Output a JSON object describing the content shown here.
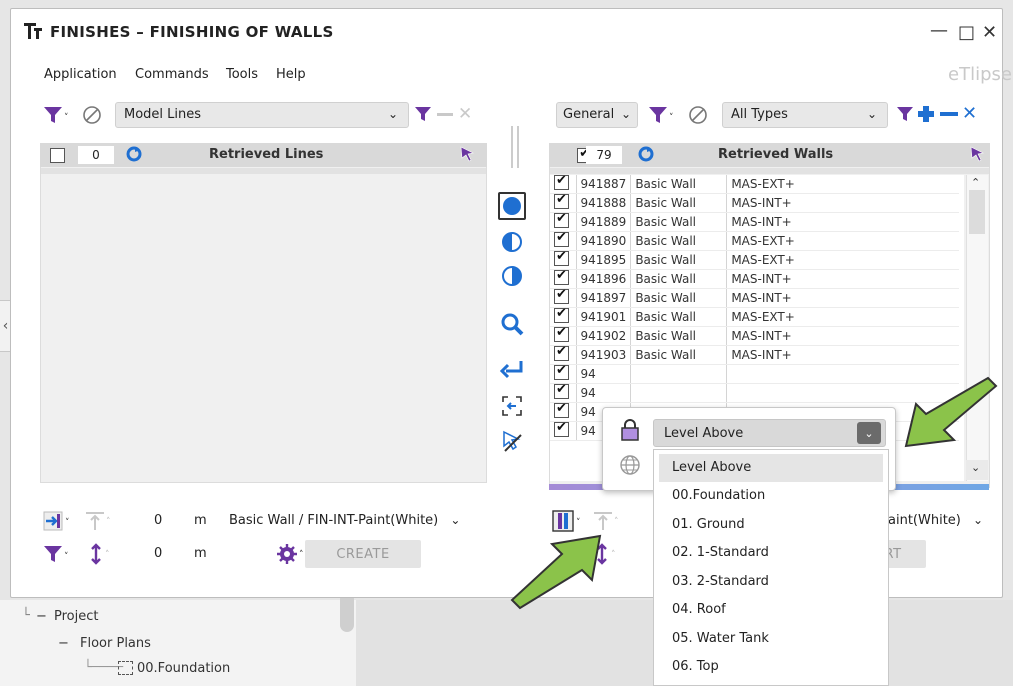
{
  "window": {
    "title": "FINISHES – FINISHING OF WALLS",
    "brand": "eTlipse",
    "controls": {
      "minimize": "—",
      "maximize": "□",
      "close": "✕"
    }
  },
  "menu": [
    "Application",
    "Commands",
    "Tools",
    "Help"
  ],
  "left_panel": {
    "category_select": "Model Lines",
    "count": "0",
    "header": "Retrieved Lines",
    "offset_value": "0",
    "offset_unit": "m",
    "wall_type_select": "Basic Wall / FIN-INT-Paint(White)",
    "height_value": "0",
    "height_unit": "m",
    "create_label": "CREATE"
  },
  "right_panel": {
    "filter_select": "General",
    "type_select": "All Types",
    "count": "79",
    "header": "Retrieved Walls",
    "rows": [
      {
        "id": "941887",
        "family": "Basic Wall",
        "type": "MAS-EXT+"
      },
      {
        "id": "941888",
        "family": "Basic Wall",
        "type": "MAS-INT+"
      },
      {
        "id": "941889",
        "family": "Basic Wall",
        "type": "MAS-INT+"
      },
      {
        "id": "941890",
        "family": "Basic Wall",
        "type": "MAS-EXT+"
      },
      {
        "id": "941895",
        "family": "Basic Wall",
        "type": "MAS-EXT+"
      },
      {
        "id": "941896",
        "family": "Basic Wall",
        "type": "MAS-INT+"
      },
      {
        "id": "941897",
        "family": "Basic Wall",
        "type": "MAS-INT+"
      },
      {
        "id": "941901",
        "family": "Basic Wall",
        "type": "MAS-EXT+"
      },
      {
        "id": "941902",
        "family": "Basic Wall",
        "type": "MAS-INT+"
      },
      {
        "id": "941903",
        "family": "Basic Wall",
        "type": "MAS-INT+"
      },
      {
        "id": "94",
        "family": "",
        "type": ""
      },
      {
        "id": "94",
        "family": "",
        "type": ""
      },
      {
        "id": "94",
        "family": "",
        "type": ""
      },
      {
        "id": "94",
        "family": "",
        "type": ""
      }
    ],
    "wall_type_select_tail": "aint(White)",
    "button_tail": "RT"
  },
  "popup": {
    "combo_value": "Level Above",
    "options": [
      "Level Above",
      "00.Foundation",
      "01. Ground",
      "02. 1-Standard",
      "03. 2-Standard",
      "04. Roof",
      "05. Water Tank",
      "06. Top"
    ]
  },
  "tree": {
    "project": "Project",
    "floor_plans": "Floor Plans",
    "first_plan": "00.Foundation"
  },
  "colors": {
    "accent_blue": "#1f6fd1",
    "filter_purple": "#6a35a0",
    "arrow_green": "#8bc34a",
    "header_gray": "#d9d9d9"
  }
}
